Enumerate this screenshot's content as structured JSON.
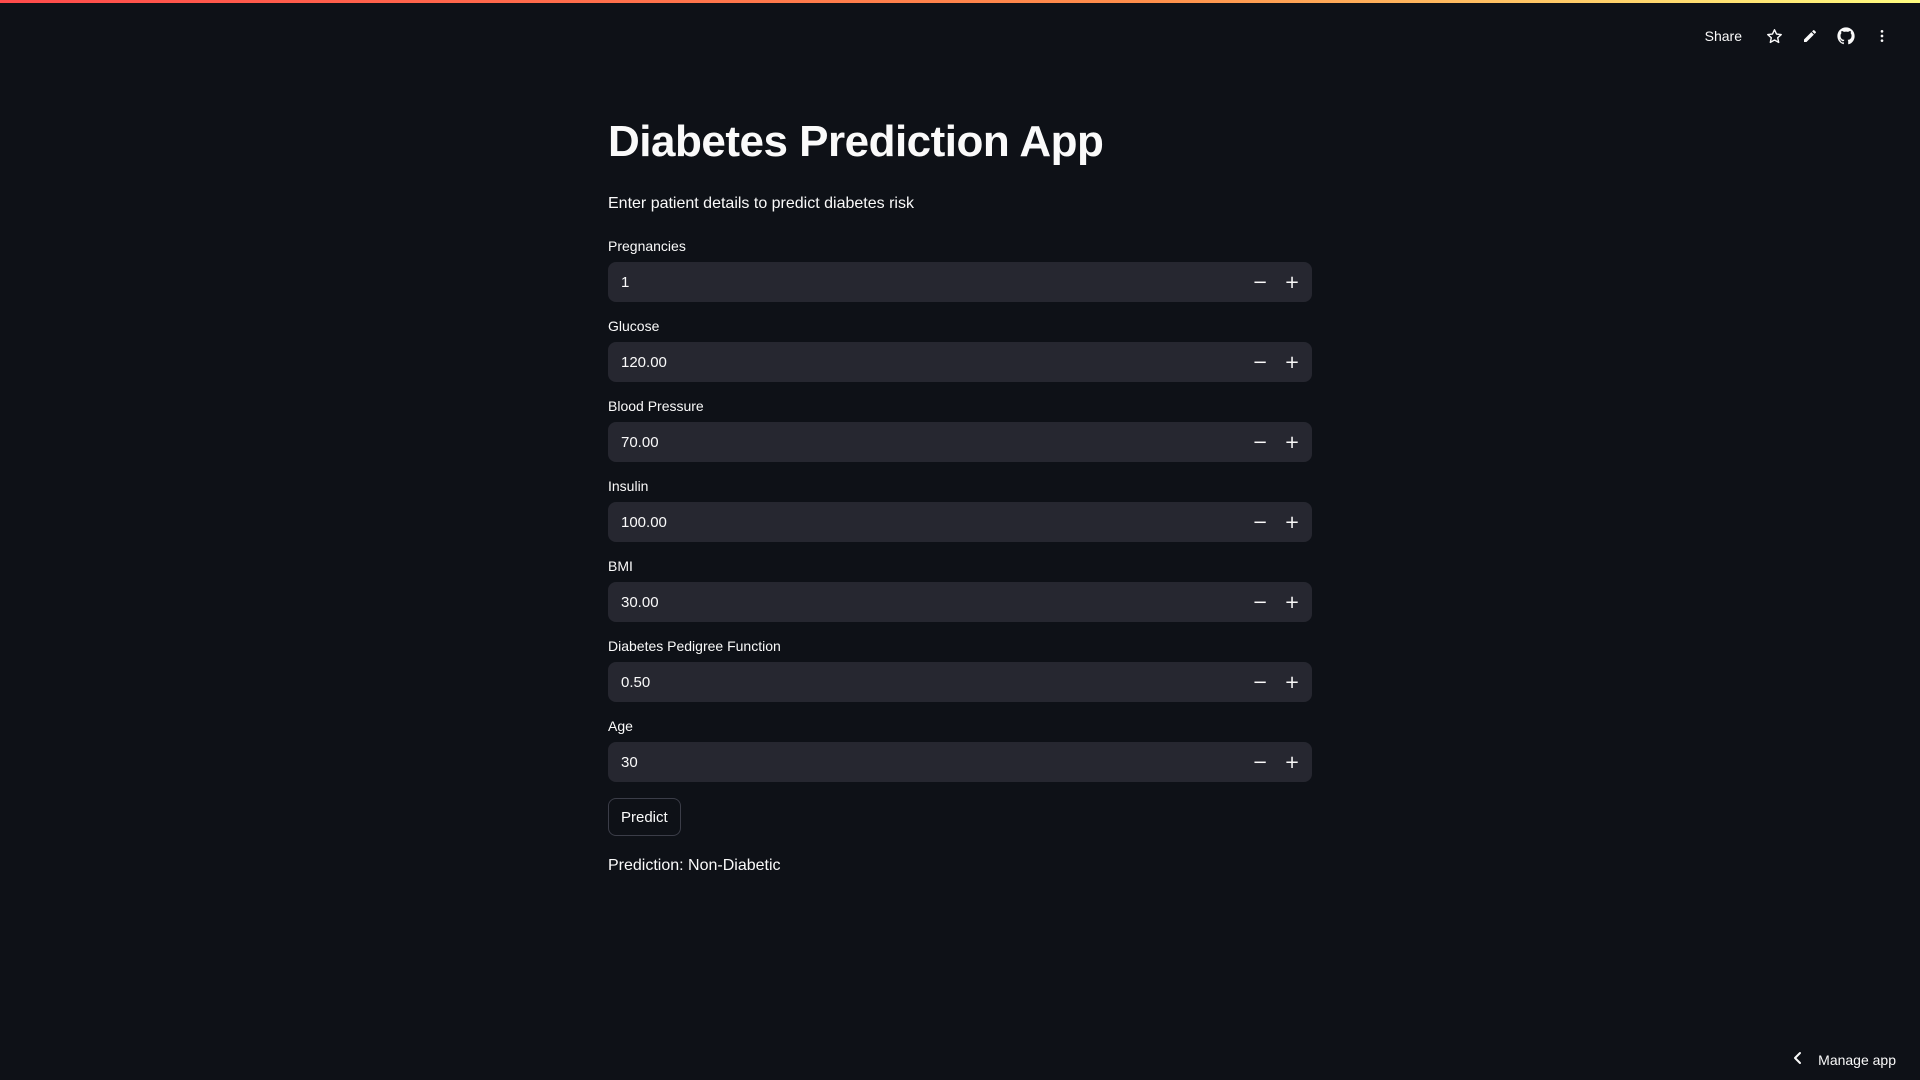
{
  "header": {
    "share_label": "Share",
    "icons": [
      "star-icon",
      "pencil-icon",
      "github-icon",
      "more-vertical-icon"
    ]
  },
  "main": {
    "title": "Diabetes Prediction App",
    "subtitle": "Enter patient details to predict diabetes risk",
    "fields": [
      {
        "label": "Pregnancies",
        "value": "1"
      },
      {
        "label": "Glucose",
        "value": "120.00"
      },
      {
        "label": "Blood Pressure",
        "value": "70.00"
      },
      {
        "label": "Insulin",
        "value": "100.00"
      },
      {
        "label": "BMI",
        "value": "30.00"
      },
      {
        "label": "Diabetes Pedigree Function",
        "value": "0.50"
      },
      {
        "label": "Age",
        "value": "30"
      }
    ],
    "step_minus": "−",
    "step_plus": "+",
    "predict_label": "Predict",
    "prediction_text": "Prediction: Non-Diabetic"
  },
  "footer": {
    "manage_app_label": "Manage app"
  },
  "colors": {
    "background": "#0e1117",
    "input_background": "#262730",
    "text": "#fafafa",
    "accent": "#ff4b4b"
  }
}
